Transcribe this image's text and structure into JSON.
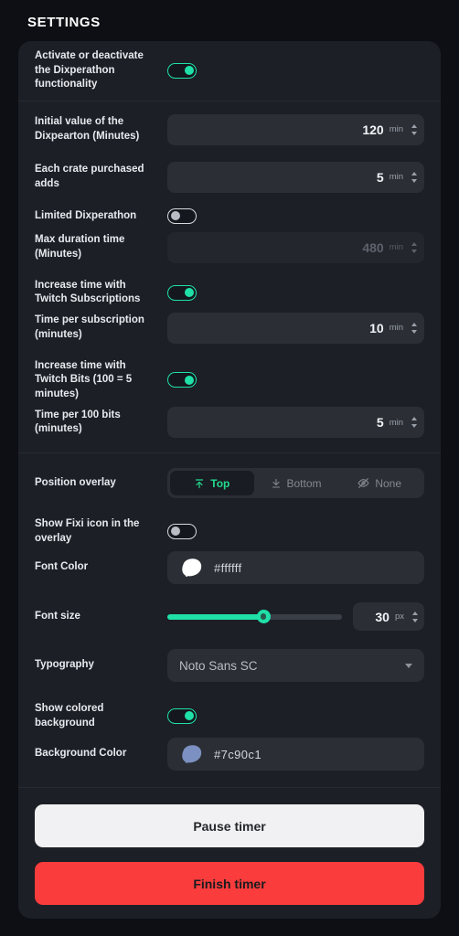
{
  "page": {
    "title": "SETTINGS"
  },
  "colors": {
    "accent": "#1fe0a8",
    "accent_text": "#22d98e",
    "danger": "#fa3c3c",
    "page_bg": "#0d0f14",
    "card_bg": "#1c1f26",
    "field_bg": "#2b2e35"
  },
  "settings": {
    "activate": {
      "label": "Activate or deactivate the Dixperathon functionality",
      "toggle_state": "on"
    },
    "initial_value": {
      "label": "Initial value of the Dixpearton (Minutes)",
      "value": "120",
      "unit": "min"
    },
    "crate_adds": {
      "label": "Each crate purchased adds",
      "value": "5",
      "unit": "min"
    },
    "limited": {
      "label": "Limited Dixperathon",
      "toggle_state": "off"
    },
    "max_duration": {
      "label": "Max duration time (Minutes)",
      "value": "480",
      "unit": "min",
      "disabled": true
    },
    "twitch_subs": {
      "label": "Increase time with Twitch Subscriptions",
      "toggle_state": "on"
    },
    "time_per_sub": {
      "label": "Time per subscription (minutes)",
      "value": "10",
      "unit": "min"
    },
    "twitch_bits": {
      "label": "Increase time with Twitch Bits (100 = 5 minutes)",
      "toggle_state": "on"
    },
    "time_per_bits": {
      "label": "Time per 100 bits (minutes)",
      "value": "5",
      "unit": "min"
    },
    "position_overlay": {
      "label": "Position overlay",
      "selected": "Top",
      "options": [
        {
          "label": "Top",
          "icon": "arrow-up-to-line-icon",
          "active": true
        },
        {
          "label": "Bottom",
          "icon": "arrow-down-to-line-icon",
          "active": false
        },
        {
          "label": "None",
          "icon": "eye-off-icon",
          "active": false
        }
      ]
    },
    "show_fixi": {
      "label": "Show Fixi icon in the overlay",
      "toggle_state": "off"
    },
    "font_color": {
      "label": "Font Color",
      "value": "#ffffff",
      "swatch": "#ffffff"
    },
    "font_size": {
      "label": "Font size",
      "value": "30",
      "unit": "px",
      "percent": 55
    },
    "typography": {
      "label": "Typography",
      "selected": "Noto Sans SC"
    },
    "colored_background": {
      "label": "Show colored background",
      "toggle_state": "on"
    },
    "background_color": {
      "label": "Background Color",
      "value": "#7c90c1",
      "swatch": "#7c90c1"
    }
  },
  "actions": {
    "pause_label": "Pause timer",
    "finish_label": "Finish timer"
  }
}
